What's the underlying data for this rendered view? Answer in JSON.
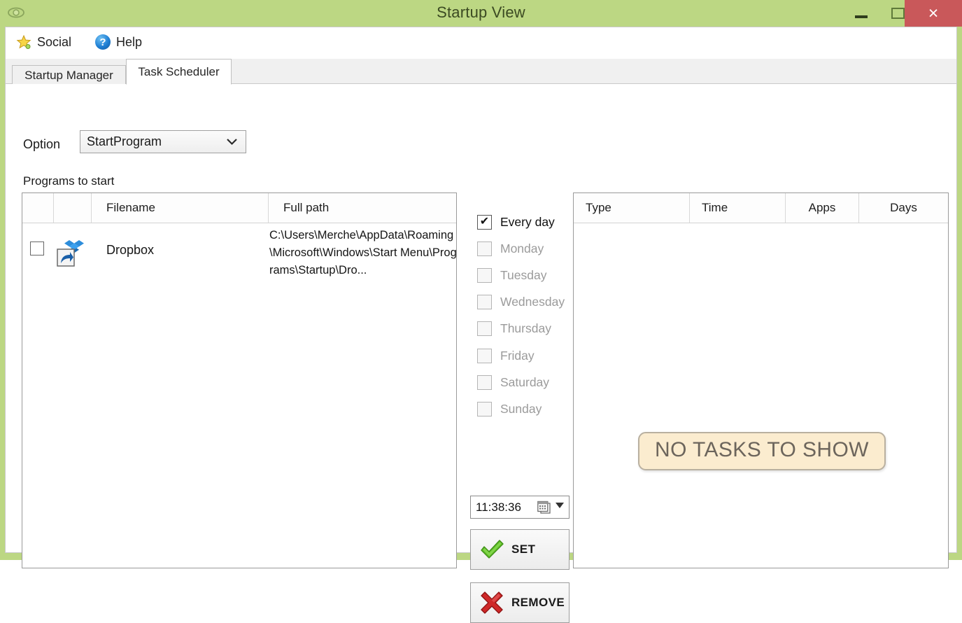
{
  "window": {
    "title": "Startup View",
    "eye_icon": "eye-icon",
    "controls": {
      "minimize": "minimize-button",
      "maximize": "maximize-button",
      "close": "close-button",
      "close_glyph": "×"
    },
    "colors": {
      "titlebar_green": "#bcd783",
      "close_red": "#c9585a",
      "badge_bg": "#fbeccf",
      "badge_text": "#6c655c"
    }
  },
  "menubar": {
    "items": [
      {
        "label": "Social",
        "icon": "star-icon"
      },
      {
        "label": "Help",
        "icon": "help-icon",
        "glyph": "?"
      }
    ]
  },
  "tabs": [
    {
      "label": "Startup Manager",
      "active": false
    },
    {
      "label": "Task Scheduler",
      "active": true
    }
  ],
  "option": {
    "label": "Option",
    "selected": "StartProgram",
    "arrow_glyph": "⌄",
    "options": [
      "StartProgram"
    ]
  },
  "programs": {
    "section_label": "Programs to start",
    "columns": [
      "",
      "",
      "Filename",
      "Full path"
    ],
    "rows": [
      {
        "checked": false,
        "icon": "dropbox-icon",
        "filename": "Dropbox",
        "fullpath": "C:\\Users\\Merche\\AppData\\Roaming\\Microsoft\\Windows\\Start Menu\\Programs\\Startup\\Dro..."
      }
    ]
  },
  "days": [
    {
      "label": "Every day",
      "checked": true,
      "enabled": true
    },
    {
      "label": "Monday",
      "checked": false,
      "enabled": false
    },
    {
      "label": "Tuesday",
      "checked": false,
      "enabled": false
    },
    {
      "label": "Wednesday",
      "checked": false,
      "enabled": false
    },
    {
      "label": "Thursday",
      "checked": false,
      "enabled": false
    },
    {
      "label": "Friday",
      "checked": false,
      "enabled": false
    },
    {
      "label": "Saturday",
      "checked": false,
      "enabled": false
    },
    {
      "label": "Sunday",
      "checked": false,
      "enabled": false
    }
  ],
  "time": {
    "value": "11:38:36",
    "picker_icon": "calendar-icon",
    "dropdown_icon": "chevron-down-icon"
  },
  "actions": {
    "set": {
      "label": "SET",
      "icon": "green-check-icon"
    },
    "remove": {
      "label": "REMOVE",
      "icon": "red-x-icon"
    }
  },
  "tasks": {
    "columns": [
      "Type",
      "Time",
      "Apps",
      "Days"
    ],
    "rows": [],
    "empty_message": "NO TASKS TO SHOW"
  }
}
